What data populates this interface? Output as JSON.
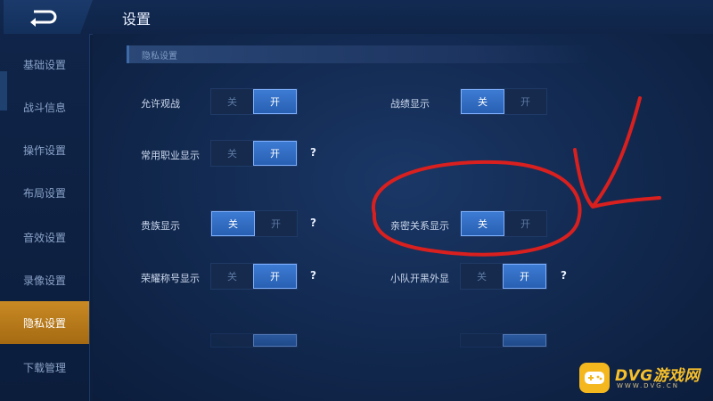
{
  "header": {
    "title": "设置"
  },
  "sidebar": {
    "items": [
      {
        "label": "基础设置",
        "active": false
      },
      {
        "label": "战斗信息",
        "active": false
      },
      {
        "label": "操作设置",
        "active": false
      },
      {
        "label": "布局设置",
        "active": false
      },
      {
        "label": "音效设置",
        "active": false
      },
      {
        "label": "录像设置",
        "active": false
      },
      {
        "label": "隐私设置",
        "active": true
      },
      {
        "label": "下载管理",
        "active": false
      }
    ]
  },
  "section": {
    "title": "隐私设置"
  },
  "toggle_labels": {
    "off": "关",
    "on": "开"
  },
  "help_symbol": "?",
  "settings": [
    {
      "label": "允许观战",
      "value": "开",
      "has_help": false
    },
    {
      "label": "战绩显示",
      "value": "关",
      "has_help": false
    },
    {
      "label": "常用职业显示",
      "value": "开",
      "has_help": true
    },
    {
      "label": "贵族显示",
      "value": "关",
      "has_help": true
    },
    {
      "label": "亲密关系显示",
      "value": "关",
      "has_help": false
    },
    {
      "label": "荣耀称号显示",
      "value": "开",
      "has_help": true
    },
    {
      "label": "小队开黑外显",
      "value": "开",
      "has_help": true
    }
  ],
  "annotation": {
    "color": "#d9201f"
  },
  "watermark": {
    "brand": "DVG游戏网",
    "domain": "WWW.DVG.CN",
    "color": "#f4b71e"
  }
}
